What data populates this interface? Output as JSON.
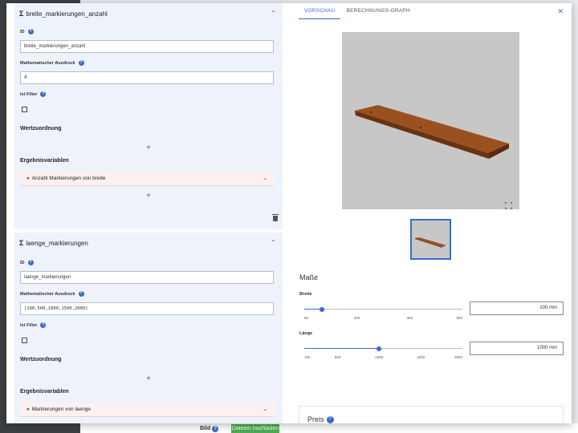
{
  "background": {
    "bild_label": "Bild",
    "upload_button": "Dateien hochladen"
  },
  "cards": [
    {
      "title": "breite_markierungen_anzahl",
      "id_label": "ID",
      "id_value": "breite_markierungen_anzahl",
      "expr_label": "Mathematischer Ausdruck",
      "expr_value": "4",
      "filter_label": "Ist Filter",
      "filter_checked": false,
      "wertzuordnung": "Wertzuordnung",
      "ergebnis": "Ergebnisvariablen",
      "result_item": "Anzahl Markierungen von breite"
    },
    {
      "title": "laenge_markierungen",
      "id_label": "ID",
      "id_value": "laenge_markierungen",
      "expr_label": "Mathematischer Ausdruck",
      "expr_value": "[100,500,1000,1500,2000]",
      "filter_label": "Ist Filter",
      "filter_checked": false,
      "wertzuordnung": "Wertzuordnung",
      "ergebnis": "Ergebnisvariablen",
      "result_item": "Markierungen von laenge"
    }
  ],
  "right": {
    "tabs": [
      {
        "label": "VORSCHAU",
        "active": true
      },
      {
        "label": "BERECHNUNGS-GRAPH",
        "active": false
      }
    ],
    "masse_title": "Maße",
    "sliders": [
      {
        "label": "Breite",
        "min": 50,
        "max": 500,
        "value": 100,
        "ticks": [
          "50",
          "200",
          "350",
          "500"
        ],
        "value_text": "100  mm"
      },
      {
        "label": "Länge",
        "min": 100,
        "max": 2000,
        "value": 1000,
        "ticks": [
          "100",
          "500",
          "1000",
          "1500",
          "2000"
        ],
        "value_text": "1000  mm"
      }
    ],
    "price_title": "Preis"
  },
  "colors": {
    "accent": "#3a6bc7",
    "card_bg": "#eef2fb",
    "result_bg": "#fdf0f0",
    "plank": "#8a4517",
    "upload": "#4caf50"
  }
}
